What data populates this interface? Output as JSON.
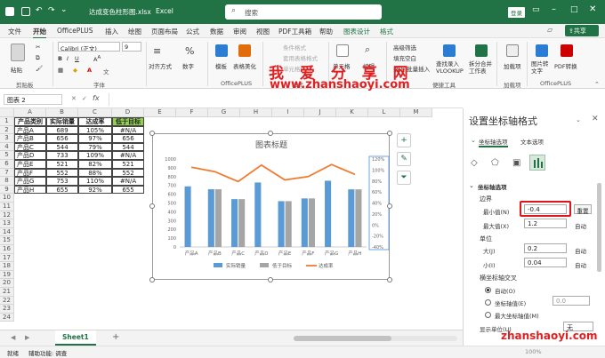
{
  "titlebar": {
    "filename": "达成变色柱形图.xlsx",
    "app": "Excel",
    "search_placeholder": "搜索",
    "login": "登录"
  },
  "menu": [
    "文件",
    "开始",
    "OfficePLUS",
    "插入",
    "绘图",
    "页面布局",
    "公式",
    "数据",
    "审阅",
    "视图",
    "PDF工具箱",
    "帮助",
    "图表设计",
    "格式"
  ],
  "share": "共享",
  "ribbon": {
    "paste": "粘贴",
    "font_name": "Calibri (正文)",
    "font_size": "9",
    "align": "对齐方式",
    "number": "数字",
    "cond_format": "条件格式",
    "table_format": "套用表格格式",
    "cell_style": "单元格样式",
    "template": "模板",
    "table_beautify": "表格美化",
    "cells": "单元格",
    "edit": "编辑",
    "filter": "高级筛选",
    "fill_blank": "填充空白",
    "insert_rows": "插入 批量插入",
    "lookup": "查找录入\nVLOOKUP",
    "split": "拆分合并\n工作表",
    "addins": "加载项",
    "image_to_text": "图片转\n文字",
    "pdf_convert": "PDF转换",
    "groups": {
      "clipboard": "剪贴板",
      "font": "字体",
      "officeplus": "OfficePLUS",
      "style": "样式",
      "tools": "便捷工具",
      "addins": "加载项",
      "officeplus2": "OfficePLUS"
    }
  },
  "formulabar": {
    "namebox": "图表 2",
    "fx": "fx"
  },
  "columns": [
    "A",
    "B",
    "C",
    "D",
    "E",
    "F",
    "G",
    "H",
    "I",
    "J",
    "K",
    "L",
    "M"
  ],
  "rows": [
    "1",
    "2",
    "3",
    "4",
    "5",
    "6",
    "7",
    "8",
    "9",
    "10",
    "11",
    "12",
    "13",
    "14",
    "15",
    "16",
    "17",
    "18",
    "19",
    "20",
    "21",
    "22",
    "23",
    "24"
  ],
  "table": {
    "headers": [
      "产品类别",
      "实际销量",
      "达成率",
      "低于目标"
    ],
    "rows": [
      [
        "产品A",
        "689",
        "105%",
        "#N/A"
      ],
      [
        "产品B",
        "656",
        "97%",
        "656"
      ],
      [
        "产品C",
        "544",
        "79%",
        "544"
      ],
      [
        "产品D",
        "733",
        "109%",
        "#N/A"
      ],
      [
        "产品E",
        "521",
        "82%",
        "521"
      ],
      [
        "产品F",
        "552",
        "88%",
        "552"
      ],
      [
        "产品G",
        "753",
        "110%",
        "#N/A"
      ],
      [
        "产品H",
        "655",
        "92%",
        "655"
      ]
    ]
  },
  "chart_data": {
    "type": "bar",
    "title": "图表标题",
    "categories": [
      "产品A",
      "产品B",
      "产品C",
      "产品D",
      "产品E",
      "产品F",
      "产品G",
      "产品H"
    ],
    "series": [
      {
        "name": "实际销量",
        "kind": "bar",
        "color": "#5b9bd5",
        "values": [
          689,
          656,
          544,
          733,
          521,
          552,
          753,
          655
        ]
      },
      {
        "name": "低于目标",
        "kind": "bar",
        "color": "#a5a5a5",
        "values": [
          null,
          656,
          544,
          null,
          521,
          552,
          null,
          655
        ]
      },
      {
        "name": "达成率",
        "kind": "line",
        "color": "#ed7d31",
        "axis": "secondary",
        "values": [
          1.05,
          0.97,
          0.79,
          1.09,
          0.82,
          0.88,
          1.1,
          0.92
        ]
      }
    ],
    "y_ticks": [
      "1000",
      "900",
      "800",
      "700",
      "600",
      "500",
      "400",
      "300",
      "200",
      "100",
      "0"
    ],
    "y2_ticks": [
      "120%",
      "100%",
      "80%",
      "60%",
      "40%",
      "20%",
      "0%",
      "-20%",
      "-40%"
    ],
    "ylim": [
      0,
      1000
    ],
    "y2lim": [
      -0.4,
      1.2
    ],
    "legend": "bottom"
  },
  "sheet": {
    "name": "Sheet1",
    "add": "+"
  },
  "status": {
    "ready": "就绪",
    "accessibility": "辅助功能: 调查",
    "zoom": "100%"
  },
  "pane": {
    "title": "设置坐标轴格式",
    "tab1": "坐标轴选项",
    "tab2": "文本选项",
    "section": "坐标轴选项",
    "bounds": "边界",
    "min_label": "最小值(N)",
    "min_value": "-0.4",
    "reset": "重置",
    "max_label": "最大值(X)",
    "max_value": "1.2",
    "auto": "自动",
    "units": "单位",
    "major_label": "大(J)",
    "major_value": "0.2",
    "minor_label": "小(I)",
    "minor_value": "0.04",
    "cross": "横坐标轴交叉",
    "cross_auto": "自动(O)",
    "cross_value": "坐标轴值(E)",
    "cross_value_num": "0.0",
    "cross_max": "最大坐标轴值(M)",
    "display_units": "显示单位(U)",
    "display_units_value": "无"
  },
  "watermark": {
    "line1": "我 爱 分 享 网",
    "line2": "www.zhanshaoyi.com",
    "line3": "zhanshaoyi.com"
  }
}
